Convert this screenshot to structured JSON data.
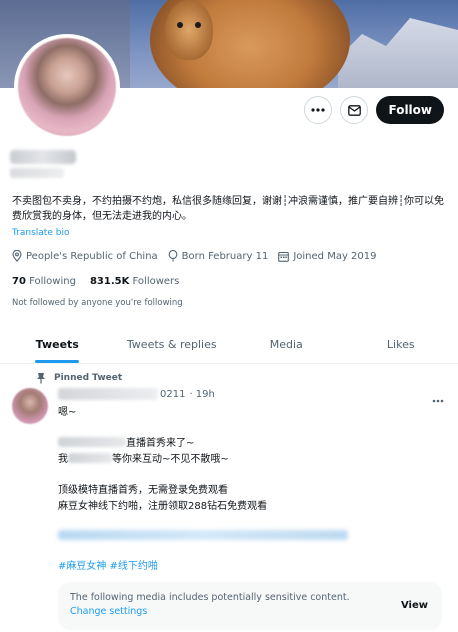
{
  "profile": {
    "bio": "不卖图包不卖身，不约拍摄不约炮，私信很多随缘回复，谢谢┆冲浪需谨慎，推广要自辨┆你可以免费欣赏我的身体，但无法走进我的内心。",
    "translate_bio": "Translate bio",
    "location": "People's Republic of China",
    "born": "Born February 11",
    "joined": "Joined May 2019",
    "following_count": "70",
    "following_label": "Following",
    "followers_count": "831.5K",
    "followers_label": "Followers",
    "not_followed": "Not followed by anyone you're following",
    "follow_label": "Follow"
  },
  "tabs": [
    {
      "label": "Tweets"
    },
    {
      "label": "Tweets & replies"
    },
    {
      "label": "Media"
    },
    {
      "label": "Likes"
    }
  ],
  "tweet": {
    "pinned_label": "Pinned Tweet",
    "handle_suffix": "0211",
    "time": "· 19h",
    "line1": "嗯~",
    "line2_end": "直播首秀来了~",
    "line3_start": "我",
    "line3_end": "等你来互动~不见不散哦~",
    "line4": "顶级模特直播首秀，无需登录免费观看",
    "line5": "麻豆女神线下约啪，注册领取288钻石免费观看",
    "hashtags": "#麻豆女神 #线下约啪",
    "sensitive_msg": "The following media includes potentially sensitive content.",
    "change_settings": "Change settings",
    "view_label": "View"
  },
  "colors": {
    "accent": "#1d9bf0",
    "text": "#0f1419",
    "secondary": "#536471"
  }
}
